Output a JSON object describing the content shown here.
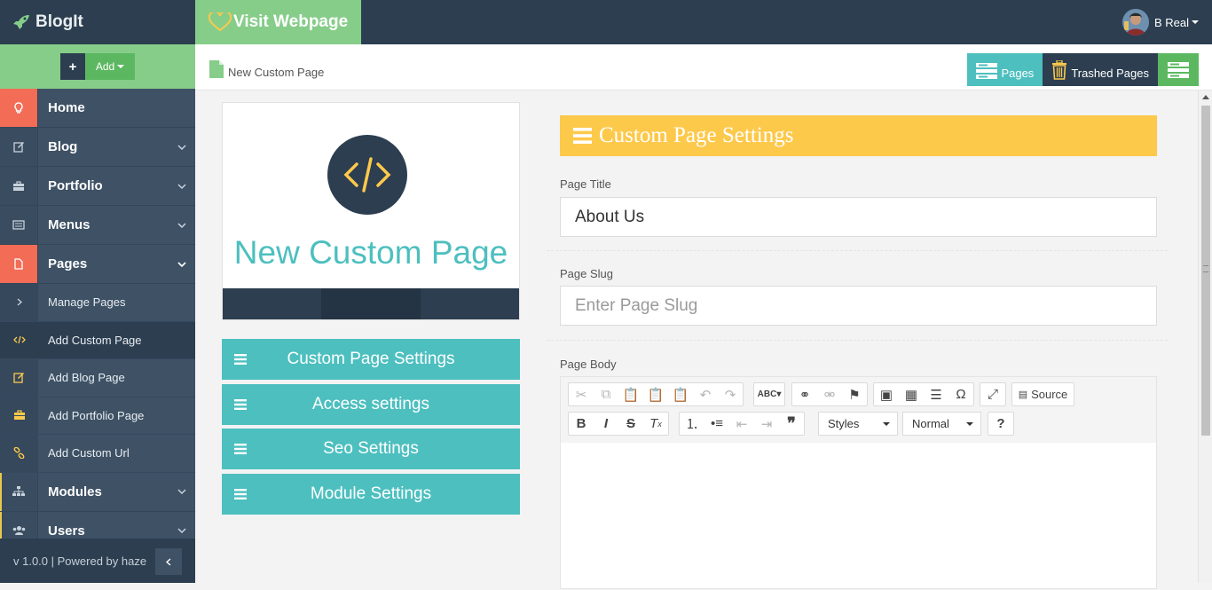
{
  "brand": {
    "name": "BlogIt",
    "icon": "rocket-icon"
  },
  "add_button": {
    "label": "Add"
  },
  "sidebar": {
    "items": [
      {
        "label": "Home",
        "icon": "lightbulb-icon"
      },
      {
        "label": "Blog",
        "icon": "edit-icon"
      },
      {
        "label": "Portfolio",
        "icon": "briefcase-icon"
      },
      {
        "label": "Menus",
        "icon": "list-icon"
      },
      {
        "label": "Pages",
        "icon": "file-icon"
      },
      {
        "label": "Modules",
        "icon": "sitemap-icon"
      },
      {
        "label": "Users",
        "icon": "users-icon"
      }
    ],
    "pages_sub": [
      {
        "label": "Manage Pages",
        "icon": "chevron-right-icon"
      },
      {
        "label": "Add Custom Page",
        "icon": "code-icon"
      },
      {
        "label": "Add Blog Page",
        "icon": "edit-icon"
      },
      {
        "label": "Add Portfolio Page",
        "icon": "briefcase-icon"
      },
      {
        "label": "Add Custom Url",
        "icon": "link-icon"
      }
    ],
    "footer": "v 1.0.0 | Powered by haze"
  },
  "topbar": {
    "visit_label": "Visit Webpage",
    "user_name": "B Real"
  },
  "breadcrumb": {
    "label": "New Custom Page"
  },
  "header_buttons": {
    "pages": "Pages",
    "trashed": "Trashed Pages"
  },
  "card": {
    "title": "New Custom Page"
  },
  "accordion": [
    {
      "label": "Custom Page Settings"
    },
    {
      "label": "Access settings"
    },
    {
      "label": "Seo Settings"
    },
    {
      "label": "Module Settings"
    }
  ],
  "panel": {
    "title": "Custom Page Settings"
  },
  "form": {
    "page_title_label": "Page Title",
    "page_title_value": "About Us",
    "page_slug_label": "Page Slug",
    "page_slug_placeholder": "Enter Page Slug",
    "page_body_label": "Page Body"
  },
  "editor": {
    "source_label": "Source",
    "styles_label": "Styles",
    "format_label": "Normal",
    "help_label": "?"
  },
  "colors": {
    "sidebar": "#3e5165",
    "dark": "#2c3e50",
    "green": "#86cd8a",
    "teal": "#4dbfbf",
    "yellow": "#fdc94b",
    "red": "#f26c56"
  }
}
